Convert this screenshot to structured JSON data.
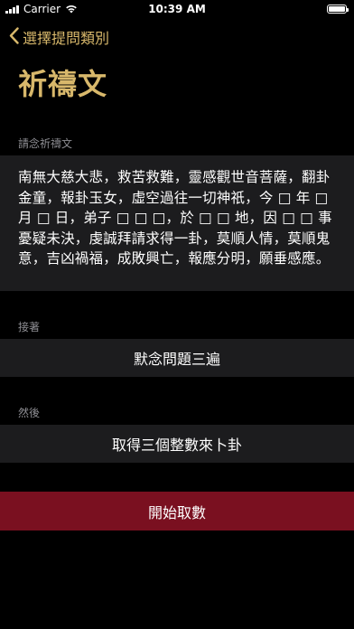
{
  "status_bar": {
    "carrier": "Carrier",
    "time": "10:39 AM",
    "signal_icon": "signal-bars-icon",
    "wifi_icon": "wifi-icon",
    "battery_icon": "battery-icon",
    "battery_level": 1.0
  },
  "nav": {
    "back_label": "選擇提問類別",
    "back_icon": "chevron-left-icon",
    "title": "祈禱文",
    "accent_color": "#d8b86b"
  },
  "prayer": {
    "header": "請念祈禱文",
    "text": "南無大慈大悲，救苦救難，靈感觀世音菩薩，翻卦金童，報卦玉女，虛空過往一切神祇，今 □ 年 □ 月 □ 日，弟子 □ □ □，於 □ □ 地，因 □ □ 事憂疑未決，虔誠拜請求得一卦，莫順人情，莫順鬼意，吉凶禍福，成敗興亡，報應分明，願垂感應。"
  },
  "step_next": {
    "header": "接著",
    "label": "默念問題三遍"
  },
  "step_then": {
    "header": "然後",
    "label": "取得三個整數來卜卦"
  },
  "action": {
    "start_label": "開始取數",
    "button_color": "#7a1020"
  }
}
